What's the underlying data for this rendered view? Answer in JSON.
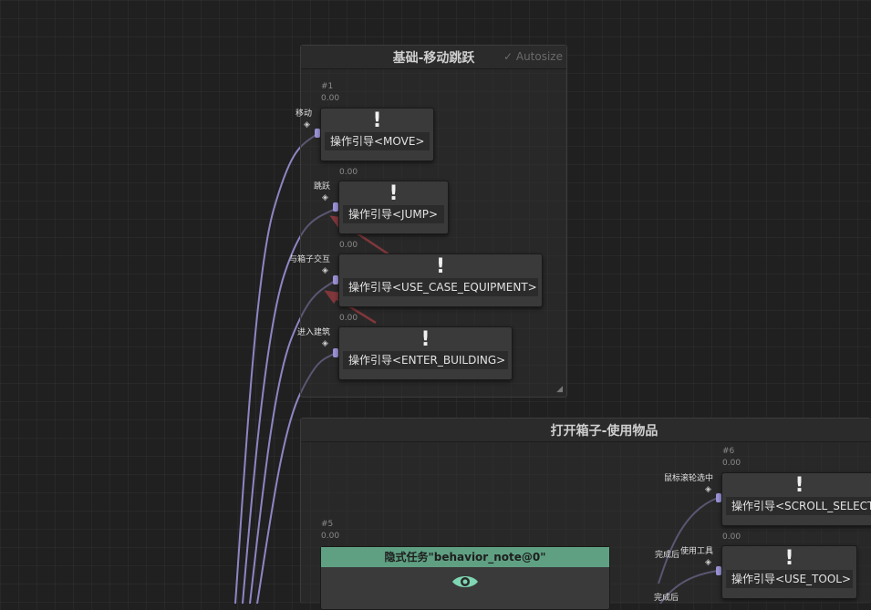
{
  "groups": {
    "g1": {
      "title": "基础-移动跳跃",
      "autosize": "Autosize"
    },
    "g2": {
      "title": "打开箱子-使用物品"
    }
  },
  "nodes": {
    "move": {
      "id": "#1",
      "value": "0.00",
      "port_label": "移动",
      "label": "操作引导<MOVE>",
      "glyph": "!"
    },
    "jump": {
      "value": "0.00",
      "port_label": "跳跃",
      "label": "操作引导<JUMP>",
      "glyph": "!"
    },
    "case": {
      "value": "0.00",
      "port_label": "与箱子交互",
      "label": "操作引导<USE_CASE_EQUIPMENT>",
      "glyph": "!"
    },
    "building": {
      "value": "0.00",
      "port_label": "进入建筑",
      "label": "操作引导<ENTER_BUILDING>",
      "glyph": "!"
    },
    "scroll": {
      "id": "#6",
      "value": "0.00",
      "port_label": "鼠标滚轮选中",
      "label": "操作引导<SCROLL_SELECTE",
      "glyph": "!"
    },
    "tool": {
      "value": "0.00",
      "port_label": "使用工具",
      "label": "操作引导<USE_TOOL>",
      "glyph": "!"
    },
    "hidden": {
      "id": "#5",
      "value": "0.00",
      "title": "隐式任务\"behavior_note@0\""
    }
  },
  "outputs": {
    "done_1": "完成后",
    "done_2": "完成后"
  },
  "icons": {
    "check": "check-icon",
    "tag": "tag-icon",
    "eye": "eye-icon",
    "resize": "resize-grip-icon"
  },
  "colors": {
    "wire": "#9a92d6",
    "arrow": "#e0404a",
    "hidden_header": "#5fa083"
  }
}
